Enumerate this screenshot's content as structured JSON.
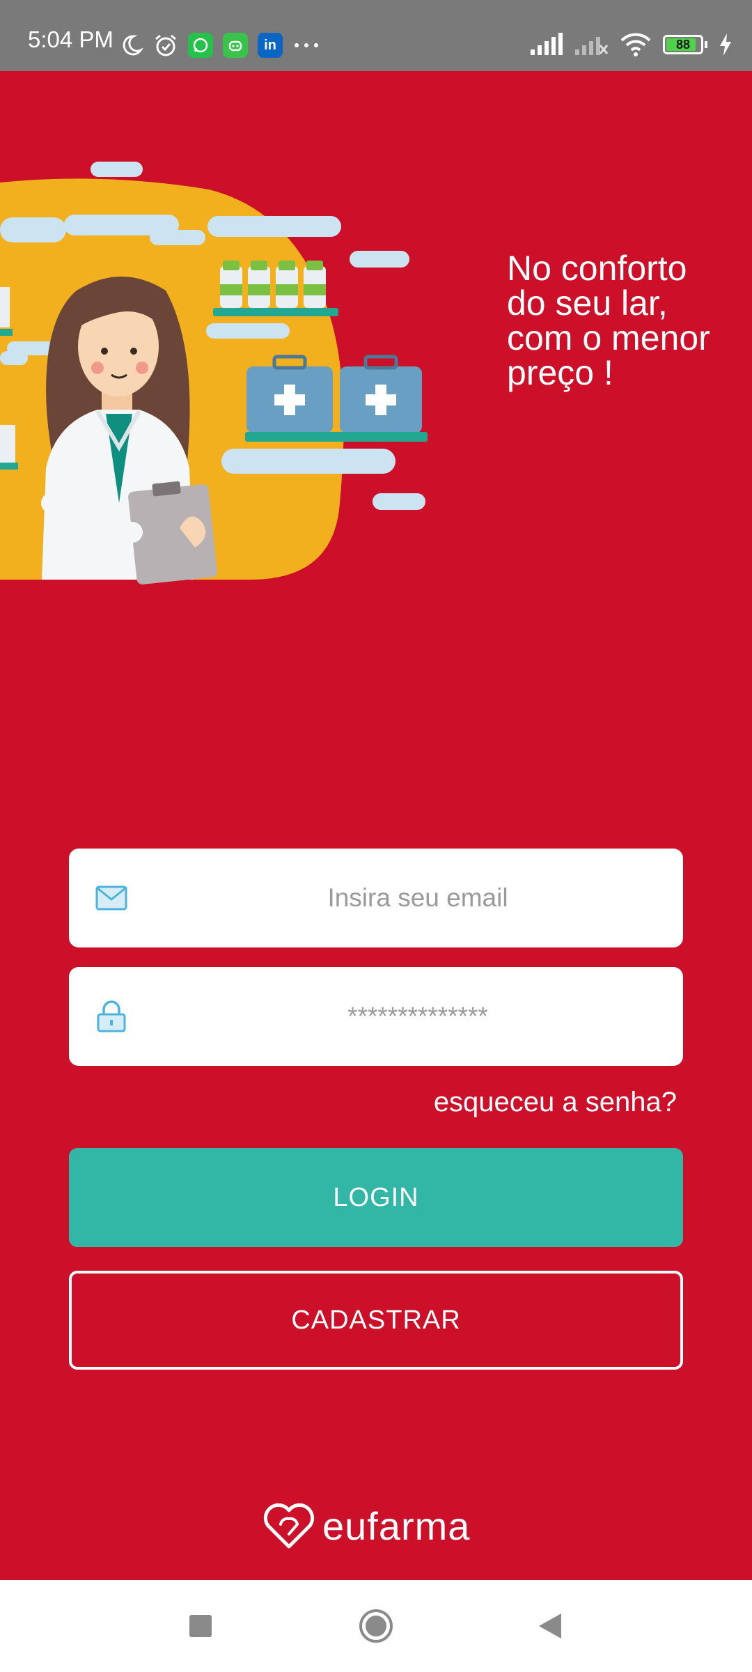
{
  "status_bar": {
    "time": "5:04 PM",
    "battery_level": "88",
    "battery_fraction": 0.88,
    "left_icons": [
      "moon-icon",
      "alarm-icon",
      "whatsapp-icon",
      "android-icon",
      "linkedin-icon",
      "more-dots-icon"
    ],
    "right_icons": [
      "signal-icon",
      "signal-no-service-icon",
      "wifi-icon",
      "battery-icon",
      "charging-icon"
    ]
  },
  "hero": {
    "tagline": "No conforto\ndo seu lar,\ncom o menor\npreço !"
  },
  "login_form": {
    "email_placeholder": "Insira seu email",
    "password_placeholder": "**************",
    "forgot_password": "esqueceu a senha?",
    "login_label": "LOGIN",
    "register_label": "CADASTRAR"
  },
  "brand": {
    "logo_text": "eufarma"
  },
  "colors": {
    "background": "#cc1029",
    "primary_button": "#32b6a5",
    "hero_circle": "#f2b01e",
    "status_bar": "#7a7a7a"
  },
  "nav_bar": {
    "icons": [
      "recents-square-icon",
      "home-circle-icon",
      "back-triangle-icon"
    ]
  }
}
